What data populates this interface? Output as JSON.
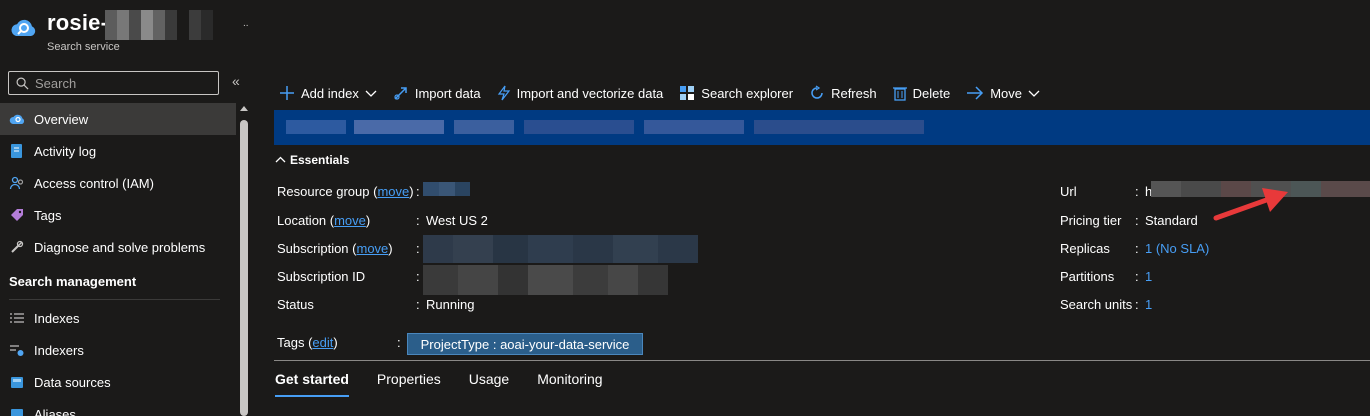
{
  "app": {
    "title": "rosie-",
    "subtitle": "Search service",
    "more": "..",
    "collapse": "«"
  },
  "search": {
    "placeholder": "Search"
  },
  "sidebar": {
    "items": [
      {
        "label": "Overview",
        "icon": "cloud-search-icon",
        "active": true
      },
      {
        "label": "Activity log",
        "icon": "activity-log-icon"
      },
      {
        "label": "Access control (IAM)",
        "icon": "people-icon"
      },
      {
        "label": "Tags",
        "icon": "tag-icon"
      },
      {
        "label": "Diagnose and solve problems",
        "icon": "wrench-icon"
      }
    ],
    "section": "Search management",
    "section_items": [
      {
        "label": "Indexes",
        "icon": "list-icon"
      },
      {
        "label": "Indexers",
        "icon": "indexer-icon"
      },
      {
        "label": "Data sources",
        "icon": "database-icon"
      },
      {
        "label": "Aliases",
        "icon": "alias-icon"
      }
    ]
  },
  "toolbar": {
    "add_index": "Add index",
    "import_data": "Import data",
    "import_vectorize": "Import and vectorize data",
    "search_explorer": "Search explorer",
    "refresh": "Refresh",
    "delete": "Delete",
    "move": "Move"
  },
  "essentials": {
    "header": "Essentials",
    "left": {
      "resource_group_label": "Resource group (",
      "resource_group_link": "move",
      "resource_group_tail": ")",
      "location_label": "Location (",
      "location_link": "move",
      "location_tail": ")",
      "location_value": "West US 2",
      "subscription_label": "Subscription (",
      "subscription_link": "move",
      "subscription_tail": ")",
      "subscription_id_label": "Subscription ID",
      "status_label": "Status",
      "status_value": "Running"
    },
    "right": {
      "url_label": "Url",
      "url_value": "h",
      "pricing_label": "Pricing tier",
      "pricing_value": "Standard",
      "replicas_label": "Replicas",
      "replicas_value": "1 (No SLA)",
      "partitions_label": "Partitions",
      "partitions_value": "1",
      "search_units_label": "Search units",
      "search_units_value": "1"
    },
    "colon": ":",
    "tags_label": "Tags (",
    "tags_link": "edit",
    "tags_tail": ")",
    "tag_chip": "ProjectType : aoai-your-data-service"
  },
  "tabs": [
    "Get started",
    "Properties",
    "Usage",
    "Monitoring"
  ],
  "colors": {
    "accent": "#479ef5",
    "banner": "#003a82",
    "arrow": "#e8393a"
  }
}
